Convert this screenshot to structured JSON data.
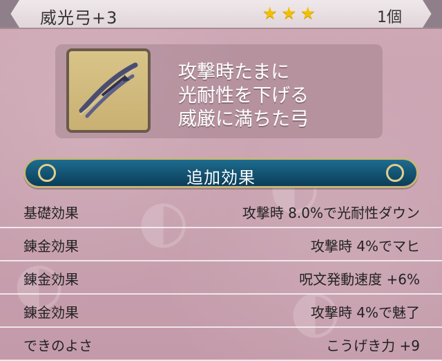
{
  "header": {
    "item_name": "威光弓+3",
    "stars": [
      "star",
      "star",
      "star"
    ],
    "quantity": "1個"
  },
  "item": {
    "icon": "bow-icon",
    "description": [
      "攻撃時たまに",
      "光耐性を下げる",
      "威厳に満ちた弓"
    ]
  },
  "section": {
    "title": "追加効果"
  },
  "effects": [
    {
      "label": "基礎効果",
      "value": "攻撃時 8.0%で光耐性ダウン"
    },
    {
      "label": "錬金効果",
      "value": "攻撃時 4%でマヒ"
    },
    {
      "label": "錬金効果",
      "value": "呪文発動速度 +6%"
    },
    {
      "label": "錬金効果",
      "value": "攻撃時 4%で魅了"
    },
    {
      "label": "できのよさ",
      "value": "こうげき力 +9"
    }
  ],
  "colors": {
    "background": "#c9a3b0",
    "section_bar": "#0b3d58",
    "star": "#f2c000",
    "icon_bg": "#d9c488"
  }
}
